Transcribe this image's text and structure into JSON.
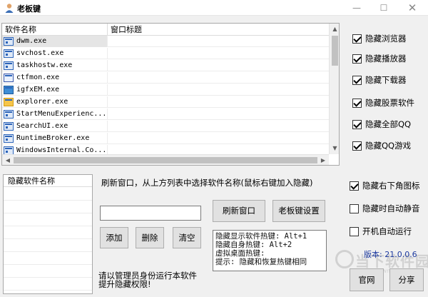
{
  "window": {
    "title": "老板键",
    "controls": {
      "minimize": "—",
      "maximize": "☐",
      "close": "✕"
    }
  },
  "process_list": {
    "columns": [
      "软件名称",
      "窗口标题"
    ],
    "rows": [
      {
        "name": "dwm.exe",
        "window_title": "",
        "icon": "app-window-icon",
        "selected": true
      },
      {
        "name": "svchost.exe",
        "window_title": "",
        "icon": "app-window-icon"
      },
      {
        "name": "taskhostw.exe",
        "window_title": "",
        "icon": "app-window-icon"
      },
      {
        "name": "ctfmon.exe",
        "window_title": "",
        "icon": "pen-icon"
      },
      {
        "name": "igfxEM.exe",
        "window_title": "",
        "icon": "graphics-icon"
      },
      {
        "name": "explorer.exe",
        "window_title": "",
        "icon": "folder-icon"
      },
      {
        "name": "StartMenuExperienc...",
        "window_title": "",
        "icon": "app-window-icon"
      },
      {
        "name": "SearchUI.exe",
        "window_title": "",
        "icon": "app-window-icon"
      },
      {
        "name": "RuntimeBroker.exe",
        "window_title": "",
        "icon": "app-window-icon"
      },
      {
        "name": "WindowsInternal.Co...",
        "window_title": "",
        "icon": "app-window-icon"
      }
    ],
    "scroll_arrows": {
      "up": "▲",
      "down": "▼",
      "left": "◀",
      "right": "▶"
    }
  },
  "options": [
    {
      "label": "隐藏浏览器",
      "checked": true
    },
    {
      "label": "隐藏播放器",
      "checked": true
    },
    {
      "label": "隐藏下载器",
      "checked": true
    },
    {
      "label": "隐藏股票软件",
      "checked": true
    },
    {
      "label": "隐藏全部QQ",
      "checked": true
    },
    {
      "label": "隐藏QQ游戏",
      "checked": true
    }
  ],
  "options2": [
    {
      "label": "隐藏右下角图标",
      "checked": true
    },
    {
      "label": "隐藏时自动静音",
      "checked": false
    },
    {
      "label": "开机自动运行",
      "checked": false
    }
  ],
  "hidden_list": {
    "header": "隐藏软件名称"
  },
  "instruction": "刷新窗口，从上方列表中选择软件名称(鼠标右键加入隐藏)",
  "name_input": {
    "value": ""
  },
  "buttons": {
    "refresh": "刷新窗口",
    "bosskey_settings": "老板键设置",
    "add": "添加",
    "delete": "删除",
    "clear": "清空",
    "website": "官网",
    "share": "分享"
  },
  "hotkeys": [
    "隐藏显示软件热键: Alt+1",
    "隐藏自身热键: Alt+2",
    "虚拟桌面热键:",
    "提示: 隐藏和恢复热键相同"
  ],
  "admin_note": [
    "请以管理员身份运行本软件",
    "提升隐藏权限!"
  ],
  "version": "版本: 21.0.0.6",
  "watermark": {
    "text": "当下软件园",
    "url": "www.downxia.com"
  },
  "colors": {
    "accent_version": "#1d3aa0",
    "window_bg": "#f0f0f0"
  }
}
